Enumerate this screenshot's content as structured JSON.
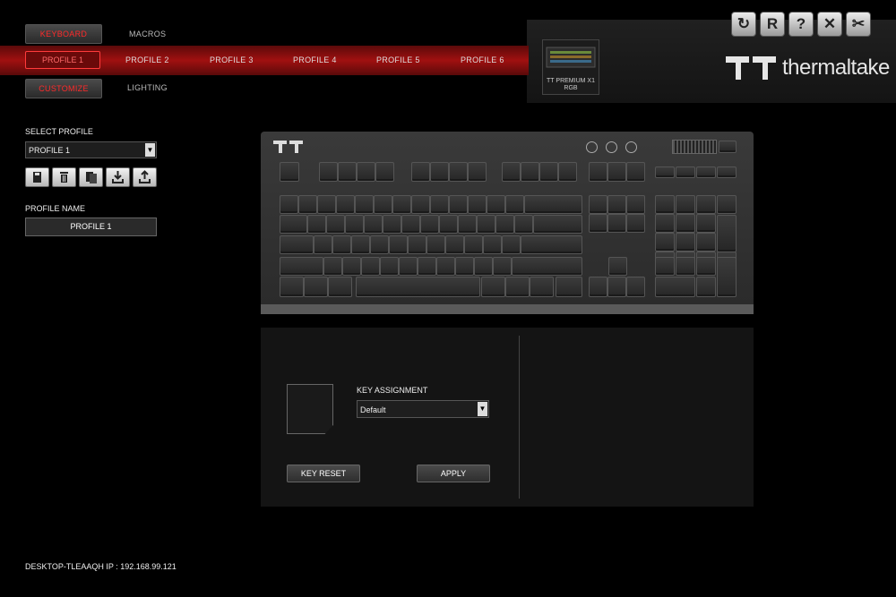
{
  "nav": {
    "keyboard_label": "KEYBOARD",
    "macros_label": "MACROS",
    "customize_label": "CUSTOMIZE",
    "lighting_label": "LIGHTING"
  },
  "profiles": [
    "PROFILE 1",
    "PROFILE 2",
    "PROFILE 3",
    "PROFILE 4",
    "PROFILE 5",
    "PROFILE 6"
  ],
  "active_profile_index": 0,
  "device": {
    "name_line1": "TT PREMIUM X1",
    "name_line2": "RGB"
  },
  "brand": {
    "wordmark": "thermaltake"
  },
  "window_icons": [
    "refresh-icon",
    "reset-icon",
    "help-icon",
    "close-icon",
    "tools-icon"
  ],
  "window_icon_glyphs": [
    "↻",
    "R",
    "?",
    "✕",
    "✂"
  ],
  "left": {
    "select_profile_label": "SELECT PROFILE",
    "select_profile_value": "PROFILE 1",
    "tool_icons": [
      "save-icon",
      "delete-icon",
      "copy-icon",
      "import-icon",
      "export-icon"
    ],
    "profile_name_label": "PROFILE NAME",
    "profile_name_value": "PROFILE 1"
  },
  "assignment": {
    "label": "KEY ASSIGNMENT",
    "value": "Default",
    "key_reset_label": "KEY RESET",
    "apply_label": "APPLY"
  },
  "status": {
    "host": "DESKTOP-TLEAAQH IP : 192.168.99.121"
  },
  "colors": {
    "accent_red": "#ff2a2a",
    "band_red": "#a01010"
  }
}
